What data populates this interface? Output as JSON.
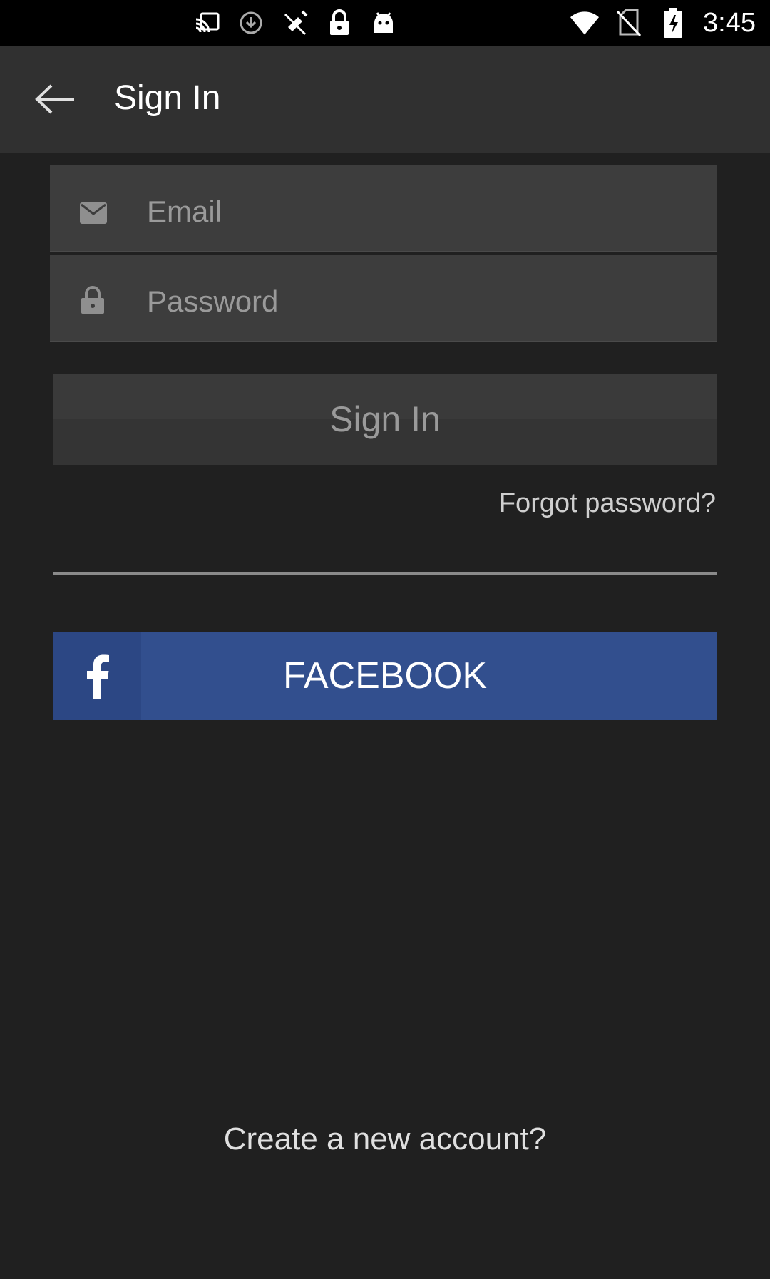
{
  "status_bar": {
    "time": "3:45",
    "icons": [
      "cast-icon",
      "download-icon",
      "gps-off-icon",
      "lock-icon",
      "android-icon",
      "wifi-icon",
      "no-sim-icon",
      "battery-charging-icon"
    ]
  },
  "toolbar": {
    "title": "Sign In",
    "back_icon": "arrow-back-icon"
  },
  "form": {
    "email": {
      "placeholder": "Email",
      "value": "",
      "icon": "mail-icon"
    },
    "password": {
      "placeholder": "Password",
      "value": "",
      "icon": "lock-icon"
    },
    "sign_in_label": "Sign In",
    "forgot_label": "Forgot password?"
  },
  "facebook": {
    "label": "FACEBOOK",
    "icon": "facebook-f-icon",
    "color": "#324f8e"
  },
  "footer": {
    "create_account": "Create a new account?"
  }
}
